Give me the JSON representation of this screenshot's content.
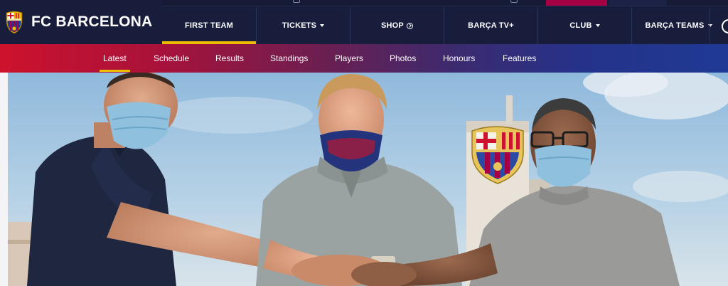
{
  "brand": {
    "name": "FC BARCELONA",
    "crest_icon": "fcb-crest-icon"
  },
  "main_nav": {
    "items": [
      {
        "label": "FIRST TEAM",
        "active": true,
        "dropdown": false
      },
      {
        "label": "TICKETS",
        "active": false,
        "dropdown": true
      },
      {
        "label": "SHOP",
        "active": false,
        "dropdown": false,
        "icon": "external-link-icon"
      },
      {
        "label": "BARÇA TV+",
        "active": false,
        "dropdown": false
      },
      {
        "label": "CLUB",
        "active": false,
        "dropdown": true
      },
      {
        "label": "BARÇA TEAMS",
        "active": false,
        "dropdown": true
      }
    ],
    "search_icon": "search-icon"
  },
  "sub_nav": {
    "items": [
      {
        "label": "Latest",
        "active": true
      },
      {
        "label": "Schedule",
        "active": false
      },
      {
        "label": "Results",
        "active": false
      },
      {
        "label": "Standings",
        "active": false
      },
      {
        "label": "Players",
        "active": false
      },
      {
        "label": "Photos",
        "active": false
      },
      {
        "label": "Honours",
        "active": false
      },
      {
        "label": "Features",
        "active": false
      }
    ]
  },
  "colors": {
    "navy": "#181d3b",
    "accent_yellow": "#edbb00",
    "blaugrana_red": "#cd122d",
    "blaugrana_blue": "#1f3a94",
    "club_claret": "#a50044"
  }
}
